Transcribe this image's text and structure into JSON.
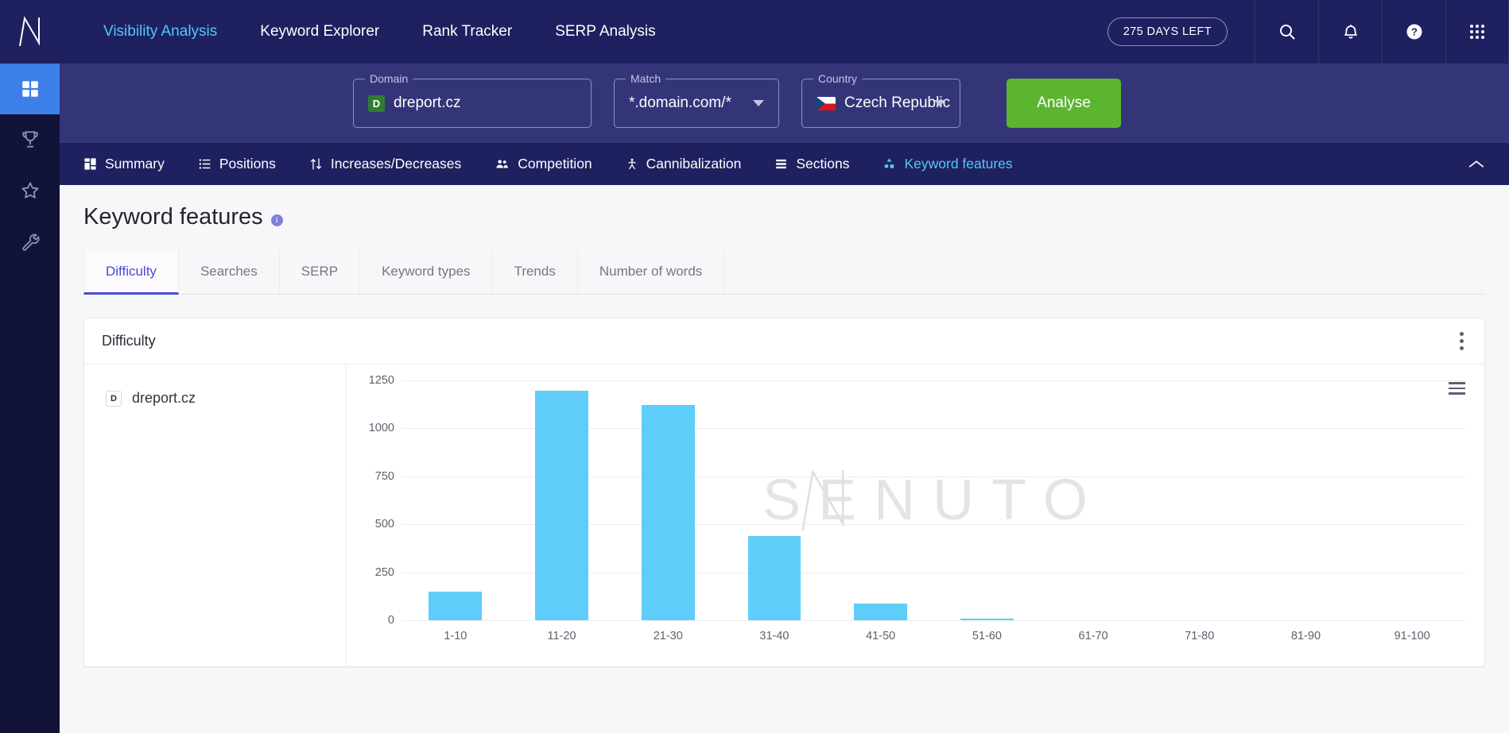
{
  "topnav": {
    "logo": "senuto-logo",
    "items": [
      {
        "label": "Visibility Analysis",
        "active": true
      },
      {
        "label": "Keyword Explorer",
        "active": false
      },
      {
        "label": "Rank Tracker",
        "active": false
      },
      {
        "label": "SERP Analysis",
        "active": false
      }
    ],
    "days_badge": "275 DAYS LEFT",
    "icons": [
      "search-icon",
      "bell-icon",
      "help-icon",
      "apps-grid-icon"
    ]
  },
  "sidebar": {
    "items": [
      {
        "name": "dashboard",
        "icon": "dashboard-icon",
        "active": true
      },
      {
        "name": "trophy",
        "icon": "trophy-icon",
        "active": false
      },
      {
        "name": "favourites",
        "icon": "star-icon",
        "active": false
      },
      {
        "name": "tools",
        "icon": "wrench-icon",
        "active": false
      }
    ]
  },
  "filters": {
    "domain": {
      "label": "Domain",
      "value": "dreport.cz",
      "favicon_letter": "D"
    },
    "match": {
      "label": "Match",
      "value": "*.domain.com/*"
    },
    "country": {
      "label": "Country",
      "value": "Czech Republic",
      "flag": "cz-flag"
    },
    "analyse_button": "Analyse"
  },
  "section_tabs": [
    {
      "label": "Summary",
      "icon": "grid-icon",
      "active": false
    },
    {
      "label": "Positions",
      "icon": "list-icon",
      "active": false
    },
    {
      "label": "Increases/Decreases",
      "icon": "arrows-updown-icon",
      "active": false
    },
    {
      "label": "Competition",
      "icon": "people-icon",
      "active": false
    },
    {
      "label": "Cannibalization",
      "icon": "person-icon",
      "active": false
    },
    {
      "label": "Sections",
      "icon": "stack-icon",
      "active": false
    },
    {
      "label": "Keyword features",
      "icon": "sitemap-icon",
      "active": true
    }
  ],
  "page": {
    "title": "Keyword features",
    "info_icon": "info-icon"
  },
  "subtabs": [
    {
      "label": "Difficulty",
      "active": true
    },
    {
      "label": "Searches",
      "active": false
    },
    {
      "label": "SERP",
      "active": false
    },
    {
      "label": "Keyword types",
      "active": false
    },
    {
      "label": "Trends",
      "active": false
    },
    {
      "label": "Number of words",
      "active": false
    }
  ],
  "card": {
    "title": "Difficulty",
    "menu_icon": "kebab-menu-icon",
    "export_icon": "hamburger-menu-icon",
    "legend": {
      "label": "dreport.cz",
      "favicon_letter": "D"
    },
    "watermark": "SENUTO"
  },
  "chart_data": {
    "type": "bar",
    "title": "Difficulty",
    "categories": [
      "1-10",
      "11-20",
      "21-30",
      "31-40",
      "41-50",
      "51-60",
      "61-70",
      "71-80",
      "81-90",
      "91-100"
    ],
    "series": [
      {
        "name": "dreport.cz",
        "values": [
          150,
          1195,
          1120,
          440,
          85,
          10,
          0,
          0,
          0,
          0
        ]
      }
    ],
    "yticks": [
      0,
      250,
      500,
      750,
      1000,
      1250
    ],
    "ylim": [
      0,
      1250
    ],
    "xlabel": "",
    "ylabel": "",
    "grid": true,
    "legend_position": "left",
    "bar_color": "#5fcdf9"
  },
  "colors": {
    "nav_bg": "#1e2060",
    "sidebar_bg": "#111338",
    "filter_bg": "#343579",
    "accent_blue": "#55c7f7",
    "accent_indigo": "#4a49d6",
    "analyse_green": "#5cb531",
    "bar_blue": "#5fcdf9"
  }
}
